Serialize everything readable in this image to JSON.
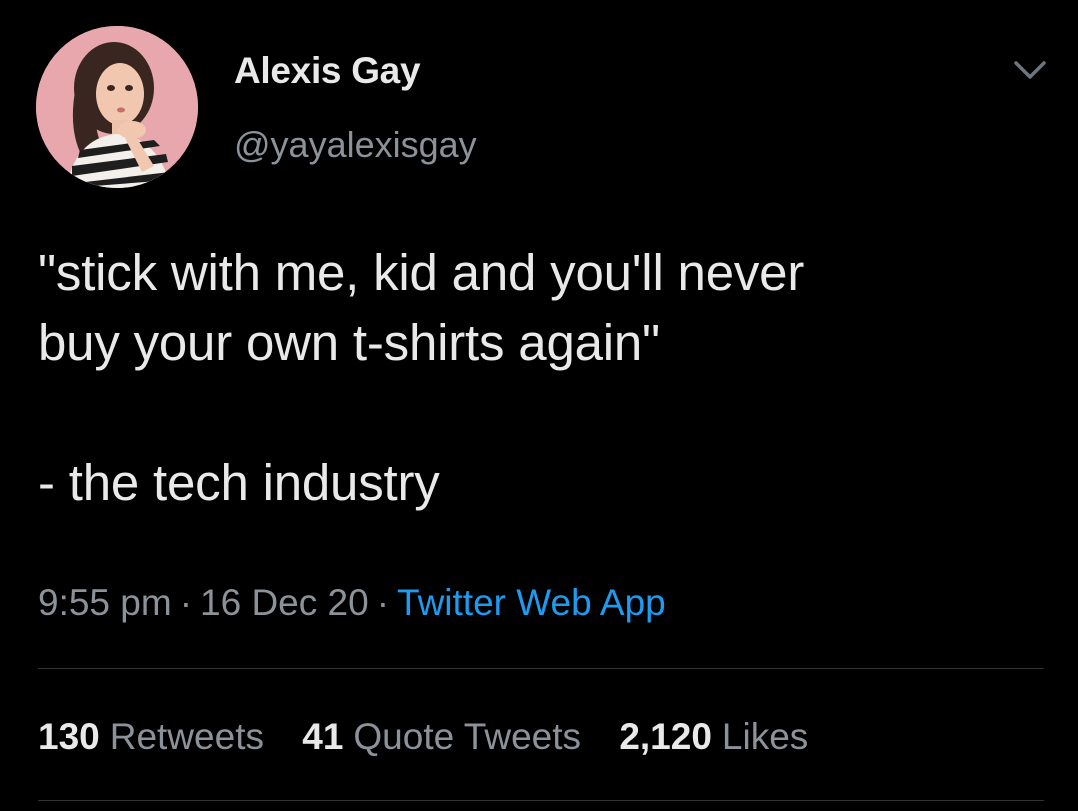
{
  "author": {
    "display_name": "Alexis Gay",
    "handle": "@yayalexisgay",
    "avatar_icon": "profile-photo"
  },
  "tweet": {
    "text": "\"stick with me, kid and you'll never\nbuy your own t-shirts again\"\n\n- the tech industry"
  },
  "meta": {
    "time": "9:55 pm",
    "separator": "·",
    "date": "16 Dec 20",
    "source": "Twitter Web App"
  },
  "stats": {
    "retweets_count": "130",
    "retweets_label": "Retweets",
    "quotes_count": "41",
    "quotes_label": "Quote Tweets",
    "likes_count": "2,120",
    "likes_label": "Likes"
  },
  "colors": {
    "background": "#000000",
    "text": "#e9e9e9",
    "secondary_text": "#8b9299",
    "link": "#1d9bf0",
    "divider": "#2f3336"
  }
}
